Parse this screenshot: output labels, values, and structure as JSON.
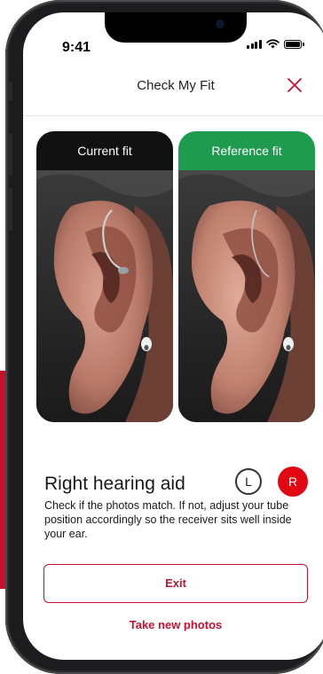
{
  "status_bar": {
    "time": "9:41"
  },
  "header": {
    "title": "Check My Fit"
  },
  "cards": {
    "current": {
      "label": "Current fit"
    },
    "reference": {
      "label": "Reference fit"
    }
  },
  "hearing_aid": {
    "title": "Right hearing aid",
    "left_label": "L",
    "right_label": "R",
    "selected_side": "R",
    "instructions": "Check if the photos match. If not, adjust  your tube position accordingly so the receiver sits well inside your ear."
  },
  "actions": {
    "exit_label": "Exit",
    "new_photos_label": "Take new photos"
  },
  "colors": {
    "accent_red": "#c8102e",
    "selected_side_red": "#e30613",
    "reference_green": "#1e9b4f"
  },
  "icons": [
    "close-icon",
    "signal-icon",
    "wifi-icon",
    "battery-icon"
  ]
}
